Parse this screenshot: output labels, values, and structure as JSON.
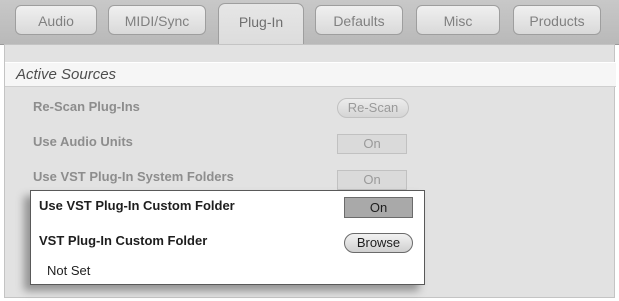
{
  "tabs": [
    {
      "label": "Audio"
    },
    {
      "label": "MIDI/Sync"
    },
    {
      "label": "Plug-In"
    },
    {
      "label": "Defaults"
    },
    {
      "label": "Misc"
    },
    {
      "label": "Products"
    }
  ],
  "active_tab": "Plug-In",
  "section": {
    "title": "Active Sources"
  },
  "rows": {
    "rescan": {
      "label": "Re-Scan Plug-Ins",
      "button": "Re-Scan"
    },
    "audio_units": {
      "label": "Use Audio Units",
      "button": "On"
    },
    "vst_system": {
      "label": "Use VST Plug-In System Folders",
      "button": "On"
    },
    "vst_custom": {
      "label": "Use VST Plug-In Custom Folder",
      "button": "On"
    },
    "custom_folder": {
      "label": "VST Plug-In Custom Folder",
      "button": "Browse",
      "value": "Not Set"
    }
  },
  "colors": {
    "tabbar_bg": "#bdbdbd",
    "panel_bg": "#e2e2e2",
    "disabled_text": "#8d8d8d",
    "highlight_border": "#595959",
    "on_button": "#a9a9a9"
  }
}
